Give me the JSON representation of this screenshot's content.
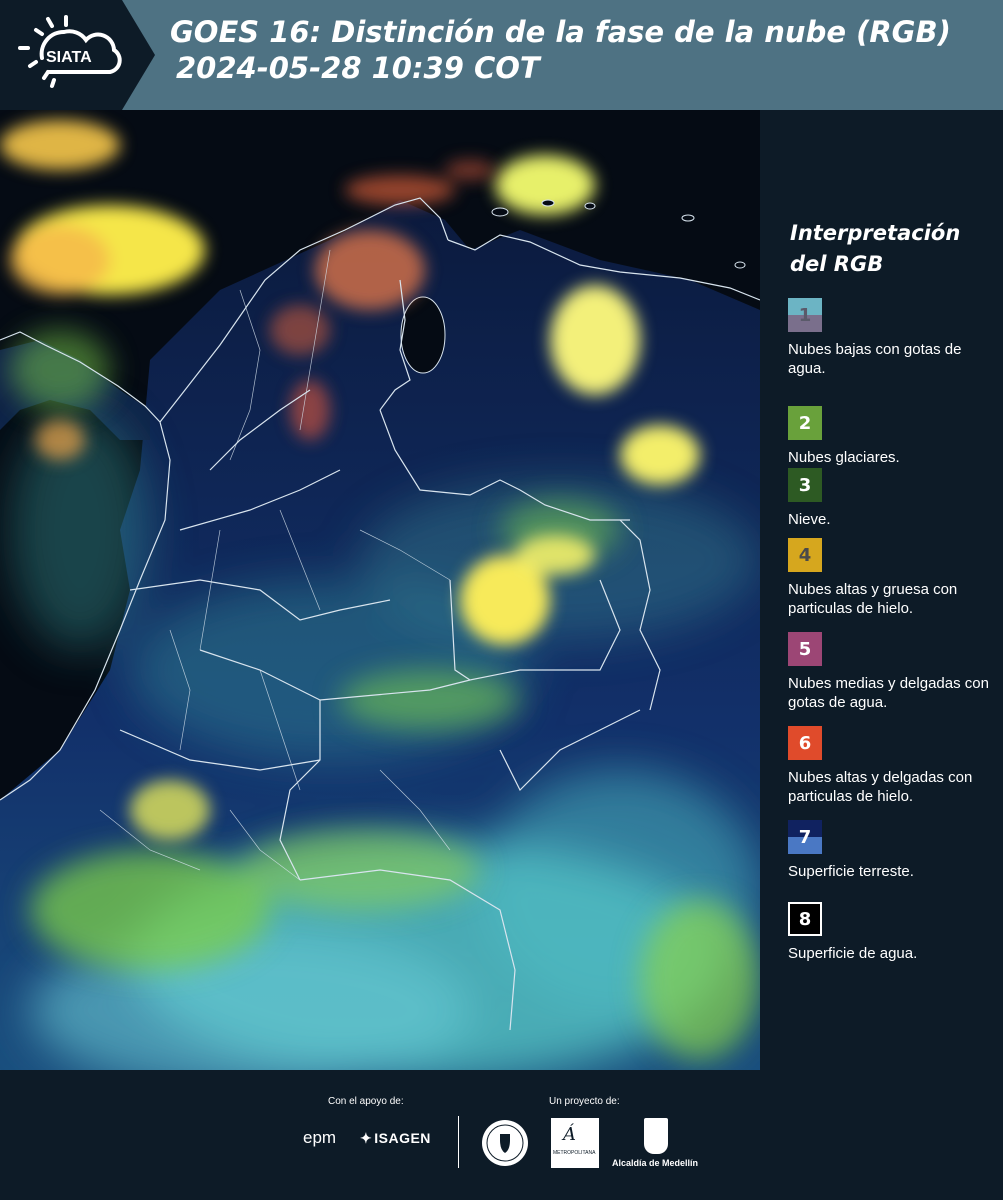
{
  "header": {
    "logo_text": "SIATA",
    "title": "GOES 16: Distinción de la fase de la nube (RGB)",
    "subtitle": "2024-05-28 10:39 COT"
  },
  "legend": {
    "title": "Interpretación del RGB",
    "items": [
      {
        "number": "1",
        "label": "Nubes bajas con gotas de agua.",
        "colors": [
          "#6cb4c4",
          "#7a6f8c"
        ],
        "num_color": "#5a5a6a"
      },
      {
        "number": "2",
        "label": "Nubes glaciares.",
        "colors": [
          "#69a13b"
        ],
        "num_color": "#ffffff"
      },
      {
        "number": "3",
        "label": "Nieve.",
        "colors": [
          "#2d5a23"
        ],
        "num_color": "#ffffff"
      },
      {
        "number": "4",
        "label": "Nubes altas y gruesa con particulas de hielo.",
        "colors": [
          "#d6a71e"
        ],
        "num_color": "#4a4a4a"
      },
      {
        "number": "5",
        "label": "Nubes medias y delgadas con gotas de agua.",
        "colors": [
          "#9c4675"
        ],
        "num_color": "#ffffff"
      },
      {
        "number": "6",
        "label": "Nubes altas y delgadas con particulas de hielo.",
        "colors": [
          "#e04b2b"
        ],
        "num_color": "#ffffff"
      },
      {
        "number": "7",
        "label": "Superficie terreste.",
        "colors": [
          "#102260",
          "#4a78c4"
        ],
        "num_color": "#ffffff"
      },
      {
        "number": "8",
        "label": "Superficie de agua.",
        "colors": [
          "#000000"
        ],
        "num_color": "#ffffff"
      }
    ]
  },
  "footer": {
    "support_label": "Con el apoyo de:",
    "project_label": "Un proyecto de:",
    "epm": "epm",
    "isagen": "ISAGEN",
    "metro_text": "METROPOLITANA",
    "alcaldia": "Alcaldía de Medellín"
  },
  "colors": {
    "header_bg": "#4e7283",
    "page_bg": "#0d1b27",
    "map_water": "#050b14",
    "map_land": "#0f1d45",
    "cloud_yellow": "#f5e64a",
    "cloud_cyan": "#5ed6cf",
    "cloud_green": "#7ccf4b",
    "border": "#d8e4ee"
  },
  "icons": [
    "siata-sun-cloud-icon",
    "isagen-mark-icon",
    "seal-icon",
    "area-metropolitana-icon",
    "medellin-shield-icon"
  ]
}
